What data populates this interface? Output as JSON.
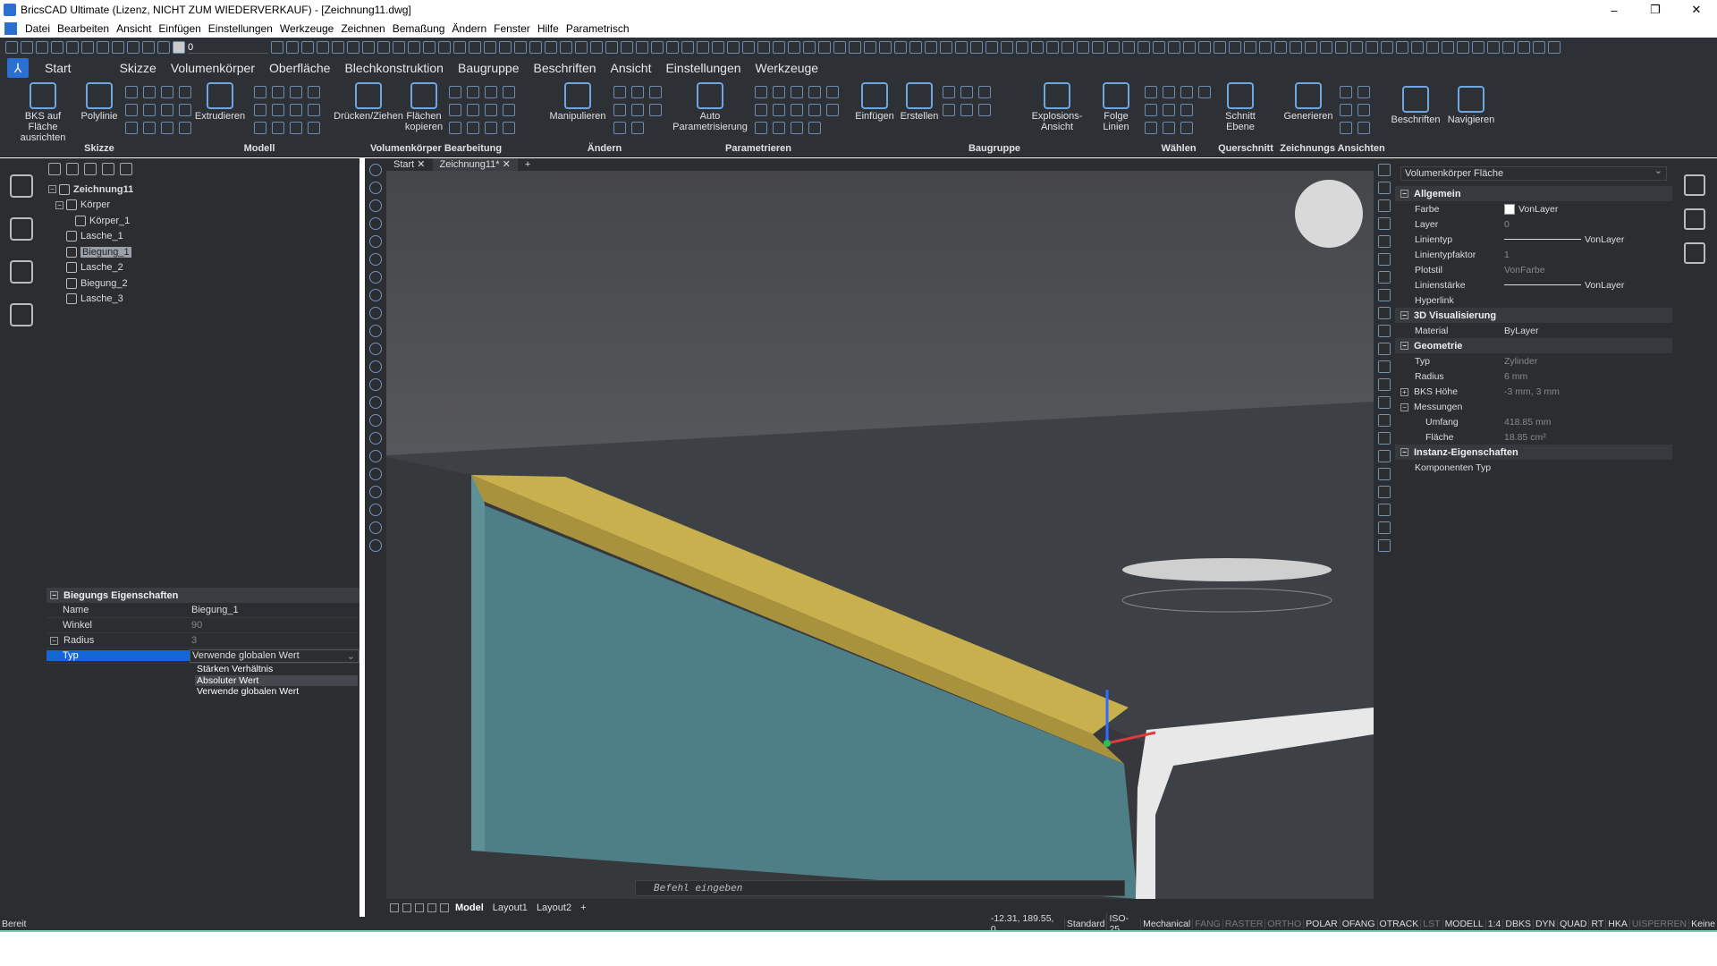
{
  "window": {
    "title": "BricsCAD Ultimate (Lizenz, NICHT ZUM WIEDERVERKAUF) - [Zeichnung11.dwg]",
    "min": "–",
    "max": "❐",
    "close": "✕"
  },
  "menu": [
    "Datei",
    "Bearbeiten",
    "Ansicht",
    "Einfügen",
    "Einstellungen",
    "Werkzeuge",
    "Zeichnen",
    "Bemaßung",
    "Ändern",
    "Fenster",
    "Hilfe",
    "Parametrisch"
  ],
  "qat": {
    "layer_value": "0"
  },
  "ribbon_tabs": [
    "Start",
    "Skizze",
    "Volumenkörper",
    "Oberfläche",
    "Blechkonstruktion",
    "Baugruppe",
    "Beschriften",
    "Ansicht",
    "Einstellungen",
    "Werkzeuge"
  ],
  "ribbon": {
    "groups": [
      "Skizze",
      "Modell",
      "Volumenkörper Bearbeitung",
      "Ändern",
      "Parametrieren",
      "Baugruppe",
      "Wählen",
      "Querschnitt",
      "Zeichnungs Ansichten"
    ],
    "buttons": {
      "bks": "BKS auf Fläche ausrichten",
      "polyline": "Polylinie",
      "extrude": "Extrudieren",
      "pushpull": "Drücken/Ziehen",
      "copyfaces": "Flächen kopieren",
      "manipulate": "Manipulieren",
      "autoparam": "Auto Parametrisierung",
      "insert": "Einfügen",
      "create": "Erstellen",
      "explode": "Explosions-Ansicht",
      "followlines": "Folge Linien",
      "section": "Schnitt Ebene",
      "generate": "Generieren",
      "annotate": "Beschriften",
      "navigate": "Navigieren"
    }
  },
  "tree": {
    "root": "Zeichnung11",
    "items": [
      {
        "label": "Körper",
        "level": 1
      },
      {
        "label": "Körper_1",
        "level": 2
      },
      {
        "label": "Lasche_1",
        "level": 1
      },
      {
        "label": "Biegung_1",
        "level": 1
      },
      {
        "label": "Lasche_2",
        "level": 1
      },
      {
        "label": "Biegung_2",
        "level": 1
      },
      {
        "label": "Lasche_3",
        "level": 1
      }
    ]
  },
  "bend_props": {
    "header": "Biegungs Eigenschaften",
    "rows": [
      {
        "k": "Name",
        "v": "Biegung_1"
      },
      {
        "k": "Winkel",
        "v": "90"
      },
      {
        "k": "Radius",
        "v": "3"
      },
      {
        "k": "Typ",
        "v": "Verwende globalen Wert"
      }
    ],
    "dropdown_options": [
      "Stärken Verhältnis",
      "Absoluter Wert",
      "Verwende globalen Wert"
    ]
  },
  "doc_tabs": [
    "Start",
    "Zeichnung11*"
  ],
  "command_placeholder": "Befehl eingeben",
  "layouts": [
    "Model",
    "Layout1",
    "Layout2"
  ],
  "properties": {
    "selector": "Volumenkörper Fläche",
    "groups": [
      {
        "title": "Allgemein",
        "rows": [
          {
            "k": "Farbe",
            "v": "VonLayer"
          },
          {
            "k": "Layer",
            "v": "0"
          },
          {
            "k": "Linientyp",
            "v": "VonLayer"
          },
          {
            "k": "Linientypfaktor",
            "v": "1"
          },
          {
            "k": "Plotstil",
            "v": "VonFarbe"
          },
          {
            "k": "Linienstärke",
            "v": "VonLayer"
          },
          {
            "k": "Hyperlink",
            "v": ""
          }
        ]
      },
      {
        "title": "3D Visualisierung",
        "rows": [
          {
            "k": "Material",
            "v": "ByLayer"
          }
        ]
      },
      {
        "title": "Geometrie",
        "rows": [
          {
            "k": "Typ",
            "v": "Zylinder"
          },
          {
            "k": "Radius",
            "v": "6 mm"
          },
          {
            "k": "BKS Höhe",
            "v": "-3 mm, 3 mm"
          },
          {
            "k": "Messungen",
            "v": ""
          },
          {
            "k": "Umfang",
            "v": "418.85 mm"
          },
          {
            "k": "Fläche",
            "v": "18.85 cm²"
          }
        ]
      },
      {
        "title": "Instanz-Eigenschaften",
        "rows": [
          {
            "k": "Komponenten Typ",
            "v": ""
          }
        ]
      }
    ]
  },
  "status": {
    "ready": "Bereit",
    "coords": "-12.31, 189.55, 0",
    "items": [
      "Standard",
      "ISO-25",
      "Mechanical",
      "FANG",
      "RASTER",
      "ORTHO",
      "POLAR",
      "OFANG",
      "OTRACK",
      "LST",
      "MODELL",
      "1:4",
      "DBKS",
      "DYN",
      "QUAD",
      "RT",
      "HKA",
      "UISPERREN",
      "Keine"
    ]
  },
  "colors": {
    "accent": "#1366d6",
    "bend_face": "#c8b04e",
    "flange": "#4f7f86",
    "panel": "#2b2d31"
  }
}
